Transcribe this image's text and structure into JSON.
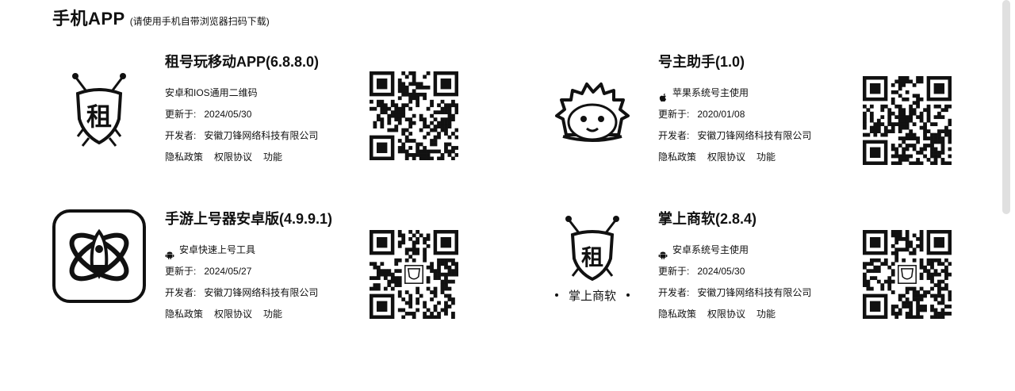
{
  "header": {
    "title": "手机APP",
    "subtitle": "(请使用手机自带浏览器扫码下载)"
  },
  "apps": [
    {
      "name": "租号玩移动APP(6.8.8.0)",
      "platform_icon": "none",
      "platform": "安卓和IOS通用二维码",
      "updated_label": "更新于:",
      "updated": "2024/05/30",
      "developer_label": "开发者:",
      "developer": "安徽刀锋网络科技有限公司",
      "links": [
        "隐私政策",
        "权限协议",
        "功能"
      ],
      "logo_icon": "zuhaowan-shield-logo-icon"
    },
    {
      "name": "号主助手(1.0)",
      "platform_icon": "apple-icon",
      "platform": "苹果系统号主使用",
      "updated_label": "更新于:",
      "updated": "2020/01/08",
      "developer_label": "开发者:",
      "developer": "安徽刀锋网络科技有限公司",
      "links": [
        "隐私政策",
        "权限协议",
        "功能"
      ],
      "logo_icon": "hedgehog-logo-icon"
    },
    {
      "name": "手游上号器安卓版(4.9.9.1)",
      "platform_icon": "android-icon",
      "platform": "安卓快速上号工具",
      "updated_label": "更新于:",
      "updated": "2024/05/27",
      "developer_label": "开发者:",
      "developer": "安徽刀锋网络科技有限公司",
      "links": [
        "隐私政策",
        "权限协议",
        "功能"
      ],
      "logo_icon": "rocket-orbit-logo-icon"
    },
    {
      "name": "掌上商软(2.8.4)",
      "platform_icon": "android-icon",
      "platform": "安卓系统号主使用",
      "updated_label": "更新于:",
      "updated": "2024/05/30",
      "developer_label": "开发者:",
      "developer": "安徽刀锋网络科技有限公司",
      "links": [
        "隐私政策",
        "权限协议",
        "功能"
      ],
      "logo_icon": "zhangshang-shangruan-logo-icon",
      "logo_caption": "掌上商软"
    }
  ]
}
